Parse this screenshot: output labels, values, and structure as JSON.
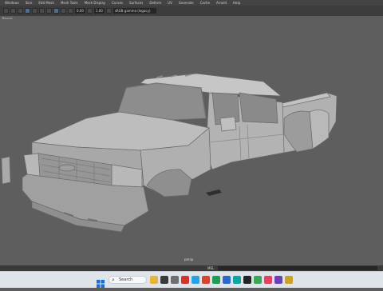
{
  "menu": [
    "Windows",
    "Skin",
    "Edit Mesh",
    "Mesh Tools",
    "Mesh Display",
    "Curves",
    "Surfaces",
    "Deform",
    "UV",
    "Generate",
    "Cache",
    "Arnold",
    "Help"
  ],
  "toolbar": {
    "field_values": [
      "0.00",
      "1.00"
    ],
    "color_space": "sRGB gamma (legacy)"
  },
  "panel_label": "Panels",
  "viewport": {
    "camera_label": "persp",
    "background": "#5e5e5e",
    "model": "pickup-truck-mesh"
  },
  "status": {
    "mel_label": "MEL"
  },
  "taskbar": {
    "search_placeholder": "Search",
    "icons": [
      "windows-icon",
      "search-icon",
      "app-icon-1",
      "app-icon-2",
      "app-icon-3",
      "app-icon-4",
      "app-icon-5",
      "app-icon-6",
      "app-icon-7",
      "app-icon-8",
      "app-icon-9",
      "app-icon-10"
    ]
  }
}
